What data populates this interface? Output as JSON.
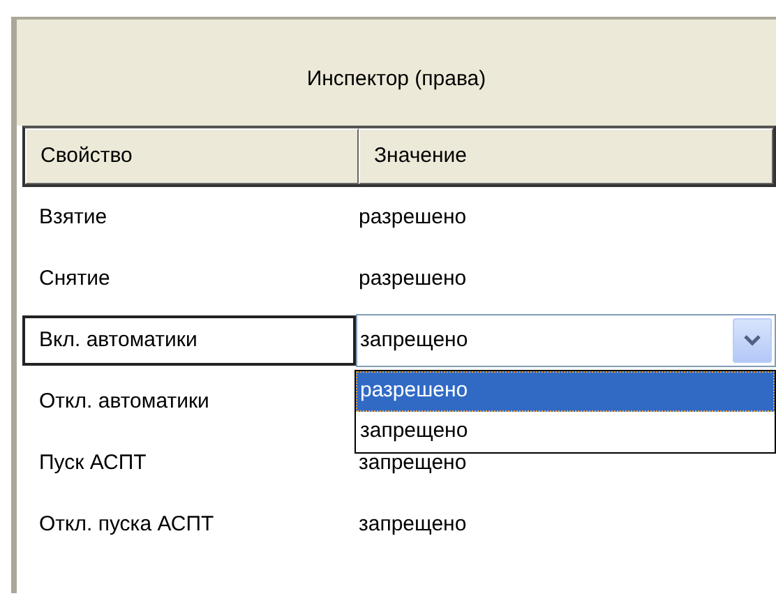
{
  "panel": {
    "title": "Инспектор (права)"
  },
  "table": {
    "columns": [
      "Свойство",
      "Значение"
    ],
    "rows": [
      {
        "property": "Взятие",
        "value": "разрешено",
        "selected": false
      },
      {
        "property": "Снятие",
        "value": "разрешено",
        "selected": false
      },
      {
        "property": "Вкл. автоматики",
        "value": "запрещено",
        "selected": true
      },
      {
        "property": "Откл. автоматики",
        "selected": false
      },
      {
        "property": "Пуск АСПТ",
        "value": "запрещено",
        "selected": false
      },
      {
        "property": "Откл. пуска АСПТ",
        "value": "запрещено",
        "selected": false
      }
    ]
  },
  "dropdown": {
    "options": [
      {
        "label": "разрешено",
        "selected": true
      },
      {
        "label": "запрещено",
        "selected": false
      }
    ]
  }
}
